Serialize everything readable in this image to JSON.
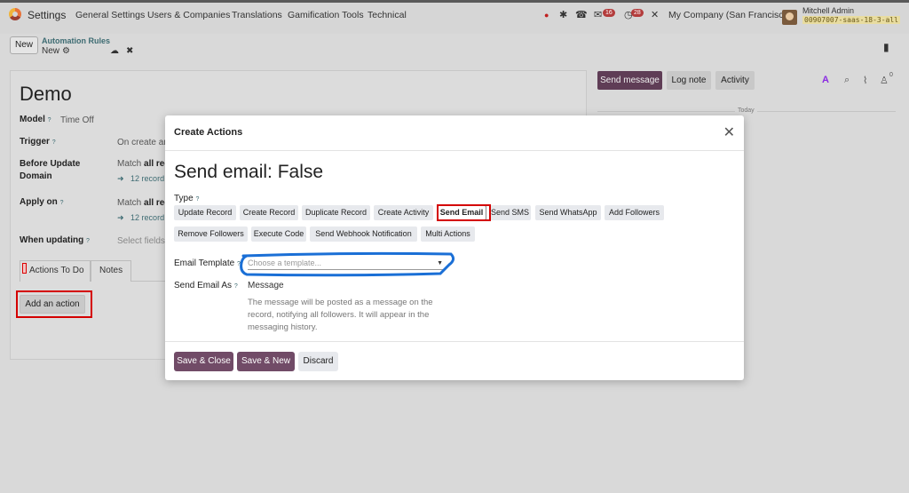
{
  "navbar": {
    "app_name": "Settings",
    "menus": [
      "General Settings",
      "Users & Companies",
      "Translations",
      "Gamification Tools",
      "Technical"
    ],
    "messages_badge": "16",
    "activities_badge": "28",
    "company": "My Company (San Francisco)",
    "user_name": "Mitchell Admin",
    "database": "00907007-saas-18-3-all"
  },
  "control_panel": {
    "new_label": "New",
    "breadcrumb": "Automation Rules",
    "record_state": "New"
  },
  "form": {
    "title": "Demo",
    "model_label": "Model",
    "model_value": "Time Off",
    "trigger_label": "Trigger",
    "trigger_value": "On create an",
    "before_update_label_1": "Before Update",
    "before_update_label_2": "Domain",
    "before_update_match_prefix": "Match ",
    "before_update_match_bold": "all rec",
    "before_update_records": "12 record",
    "apply_on_label": "Apply on",
    "apply_on_match_prefix": "Match ",
    "apply_on_match_bold": "all rec",
    "apply_on_records": "12 record",
    "when_updating_label": "When updating",
    "when_updating_placeholder": "Select fields...",
    "tabs": [
      "Actions To Do",
      "Notes"
    ],
    "add_action_label": "Add an action"
  },
  "chatter": {
    "send_message": "Send message",
    "log_note": "Log note",
    "activity": "Activity",
    "followers_count": "0",
    "today": "Today"
  },
  "modal": {
    "title": "Create Actions",
    "heading": "Send email: False",
    "type_label": "Type",
    "type_options": [
      "Update Record",
      "Create Record",
      "Duplicate Record",
      "Create Activity",
      "Send Email",
      "Send SMS",
      "Send WhatsApp",
      "Add Followers",
      "Remove Followers",
      "Execute Code",
      "Send Webhook Notification",
      "Multi Actions"
    ],
    "selected_type": "Send Email",
    "email_template_label": "Email Template",
    "email_template_placeholder": "Choose a template...",
    "send_email_as_label": "Send Email As",
    "send_email_as_value": "Message",
    "send_email_as_help": "The message will be posted as a message on the record, notifying all followers. It will appear in the messaging history.",
    "buttons": {
      "save_close": "Save & Close",
      "save_new": "Save & New",
      "discard": "Discard"
    }
  },
  "colors": {
    "primary": "#714b67",
    "highlight_red": "#d40000",
    "annotation_blue": "#1a6fd6"
  }
}
